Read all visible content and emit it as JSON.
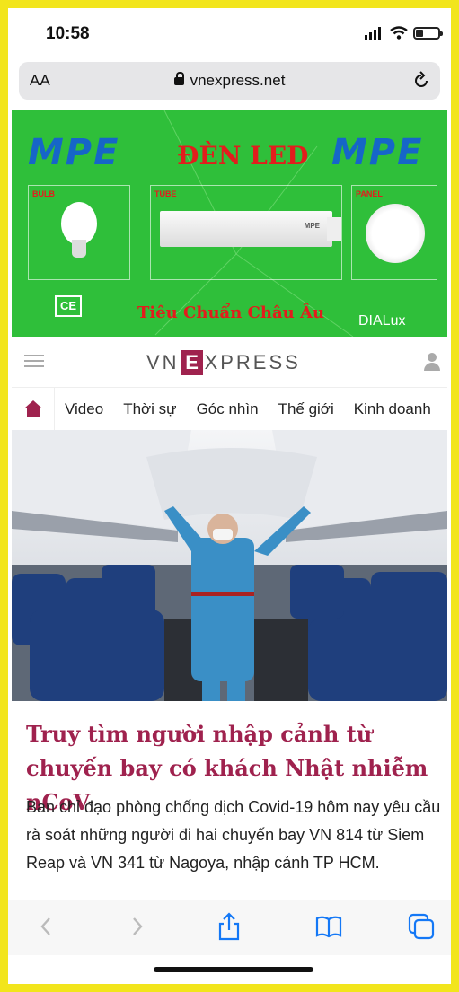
{
  "status_bar": {
    "time": "10:58",
    "signal_icon": "signal-bars-icon",
    "wifi_icon": "wifi-icon",
    "battery_icon": "battery-icon",
    "battery_level": 0.25
  },
  "browser": {
    "text_size_label": "AA",
    "url": "vnexpress.net",
    "lock_icon": "lock-icon",
    "reload_icon": "reload-icon"
  },
  "ad": {
    "brand_left": "MPE",
    "title": "ĐÈN LED",
    "brand_right": "MPE",
    "product_labels": [
      "BULB",
      "TUBE",
      "PANEL"
    ],
    "tube_brand": "MPE",
    "ce_mark": "CE",
    "tagline": "Tiêu Chuẩn Châu Âu",
    "dialux": "DIALux",
    "background_color": "#2fbf3a",
    "title_color": "#e21d1d",
    "brand_color": "#1666c8"
  },
  "site": {
    "logo_left": "VN",
    "logo_e": "E",
    "logo_right": "XPRESS",
    "accent_color": "#9f224e"
  },
  "nav": {
    "home_icon": "home-icon",
    "items": [
      "Video",
      "Thời sự",
      "Góc nhìn",
      "Thế giới",
      "Kinh doanh"
    ]
  },
  "article": {
    "image_alt": "Nhân viên kỹ thuật trong khoang máy bay",
    "headline": "Truy tìm người nhập cảnh từ chuyến bay có khách Nhật nhiễm nCoV",
    "lead": "Ban chỉ đạo phòng chống dịch Covid-19 hôm nay yêu cầu rà soát những người đi hai chuyến bay VN 814 từ Siem Reap và VN 341 từ Nagoya, nhập cảnh TP HCM."
  },
  "toolbar": {
    "back_icon": "back-arrow-icon",
    "forward_icon": "forward-arrow-icon",
    "share_icon": "share-icon",
    "bookmarks_icon": "bookmarks-icon",
    "tabs_icon": "tabs-icon"
  }
}
